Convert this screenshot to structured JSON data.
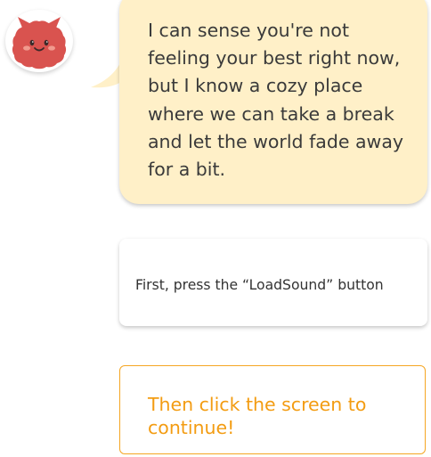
{
  "assistant": {
    "avatar_icon": "red-monster-mascot-icon",
    "message": "I can sense you're not feeling your best right now, but I know a cozy place where we can take a break and let the world fade away for a bit."
  },
  "instruction": {
    "text": "First,  press the “LoadSound” button"
  },
  "continue_prompt": {
    "text": "Then click the screen to continue!"
  },
  "colors": {
    "bubble": "#fff0c8",
    "accent": "#f39c12",
    "mascot": "#d9534f"
  }
}
